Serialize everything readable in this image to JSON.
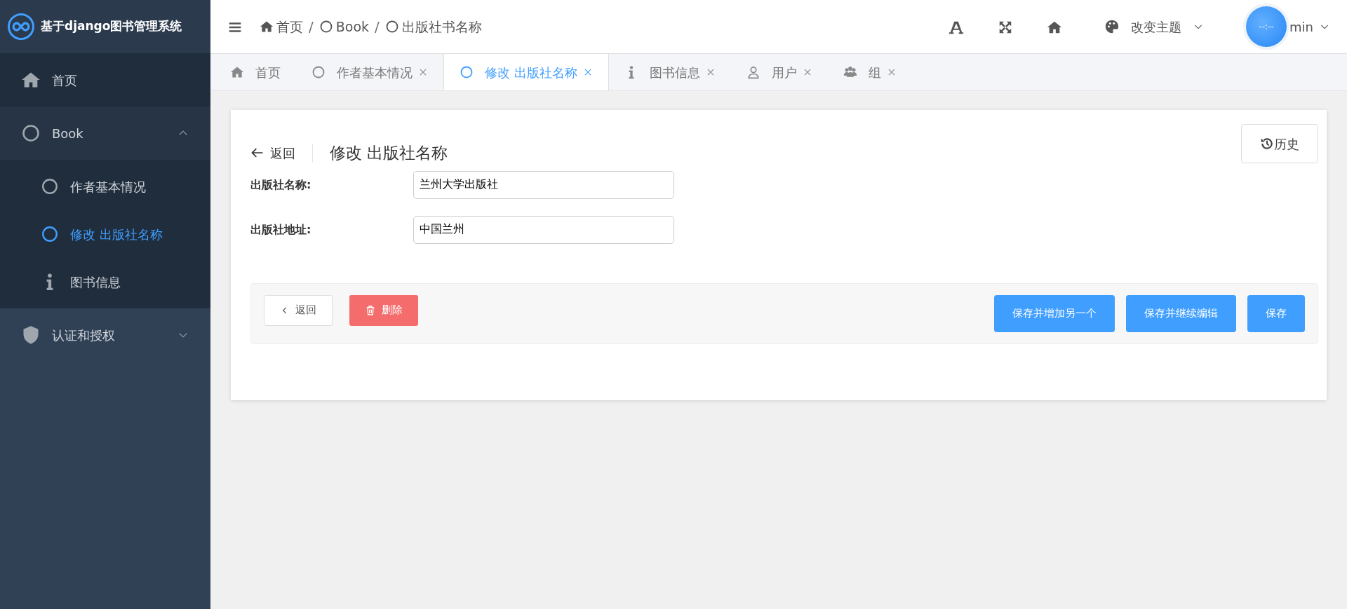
{
  "app": {
    "title": "基于django图书管理系统"
  },
  "breadcrumb": [
    {
      "label": "首页",
      "kind": "home"
    },
    {
      "separator": "/",
      "label": "Book",
      "kind": "circle"
    },
    {
      "separator": "/",
      "label": "出版社书名称",
      "kind": "circle"
    }
  ],
  "header": {
    "theme_label": "改变主题",
    "avatar_text": "--:--",
    "username": "min"
  },
  "sidebar": {
    "items": [
      {
        "label": "首页",
        "kind": "home",
        "selected": false
      },
      {
        "label": "Book",
        "kind": "circle",
        "selected": false,
        "expanded": true,
        "children": [
          {
            "label": "作者基本情况",
            "kind": "circle",
            "selected": false
          },
          {
            "label": "修改 出版社名称",
            "kind": "circle",
            "selected": true
          },
          {
            "label": "图书信息",
            "kind": "info",
            "selected": false
          }
        ]
      },
      {
        "label": "认证和授权",
        "kind": "shield",
        "selected": false,
        "expanded": false
      }
    ]
  },
  "tabs": [
    {
      "label": "首页",
      "kind": "home",
      "selected": false,
      "closable": false
    },
    {
      "label": "作者基本情况",
      "kind": "circle",
      "selected": false,
      "closable": true
    },
    {
      "label": "修改 出版社名称",
      "kind": "circle",
      "selected": true,
      "closable": true
    },
    {
      "label": "图书信息",
      "kind": "info",
      "selected": false,
      "closable": true
    },
    {
      "label": "用户",
      "kind": "user",
      "selected": false,
      "closable": true
    },
    {
      "label": "组",
      "kind": "users",
      "selected": false,
      "closable": true
    }
  ],
  "page": {
    "back_label": "返回",
    "title": "修改 出版社名称",
    "history_label": "历史"
  },
  "form": {
    "fields": [
      {
        "label": "出版社名称:",
        "value": "兰州大学出版社"
      },
      {
        "label": "出版社地址:",
        "value": "中国兰州"
      }
    ]
  },
  "actions": {
    "left": [
      {
        "label": "返回",
        "kind": "back"
      },
      {
        "label": "删除",
        "kind": "delete"
      }
    ],
    "right": [
      {
        "label": "保存并增加另一个",
        "kind": "primary"
      },
      {
        "label": "保存并继续编辑",
        "kind": "primary"
      },
      {
        "label": "保存",
        "kind": "primary"
      }
    ]
  }
}
